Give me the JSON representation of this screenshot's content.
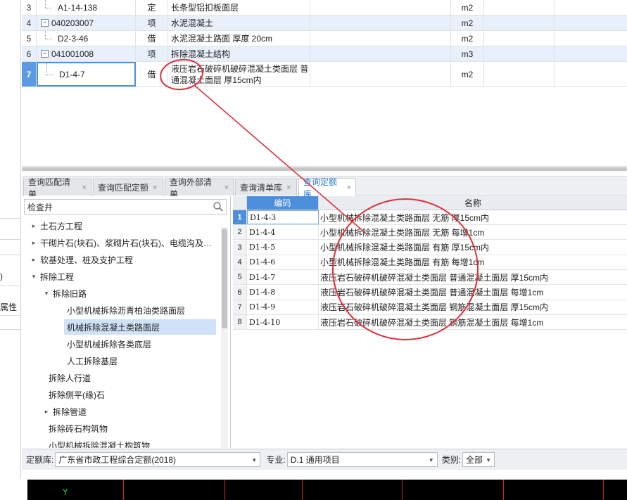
{
  "top_rows": [
    {
      "num": "3",
      "code": "A1-14-138",
      "type": "定",
      "name": "长条型铝扣板面层",
      "unit": "m2",
      "level": "child"
    },
    {
      "num": "4",
      "code": "040203007",
      "type": "项",
      "name": "水泥混凝土",
      "unit": "m2",
      "level": "parent"
    },
    {
      "num": "5",
      "code": "D2-3-46",
      "type": "借",
      "name": "水泥混凝土路面 厚度 20cm",
      "unit": "m2",
      "level": "child"
    },
    {
      "num": "6",
      "code": "041001008",
      "type": "项",
      "name": "拆除混凝土结构",
      "unit": "m3",
      "level": "parent"
    }
  ],
  "row7": {
    "num": "7",
    "code": "D1-4-7",
    "type": "借",
    "name_line1": "液压岩石破碎机破碎混凝土类面层 普",
    "name_line2": "通混凝土面层 厚15cm内",
    "unit": "m2"
  },
  "tabs": [
    {
      "label": "查询匹配清单",
      "active": false
    },
    {
      "label": "查询匹配定额",
      "active": false
    },
    {
      "label": "查询外部清单",
      "active": false
    },
    {
      "label": "查询清单库",
      "active": false
    },
    {
      "label": "查询定额库",
      "active": true
    }
  ],
  "tab_close": "×",
  "search": {
    "value": "检查井"
  },
  "tree": [
    {
      "label": "土石方工程",
      "arrow": "▸",
      "indent": 0
    },
    {
      "label": "干砌片石(块石)、浆砌片石(块石)、电缆沟及…",
      "arrow": "▸",
      "indent": 0
    },
    {
      "label": "软基处理、桩及支护工程",
      "arrow": "▸",
      "indent": 0
    },
    {
      "label": "拆除工程",
      "arrow": "▾",
      "indent": 0
    },
    {
      "label": "拆除旧路",
      "arrow": "▾",
      "indent": 1
    },
    {
      "label": "小型机械拆除沥青柏油类路面层",
      "arrow": "",
      "indent": 2
    },
    {
      "label": "机械拆除混凝土类路面层",
      "arrow": "",
      "indent": 2,
      "selected": true
    },
    {
      "label": "小型机械拆除各类底层",
      "arrow": "",
      "indent": 2
    },
    {
      "label": "人工拆除基层",
      "arrow": "",
      "indent": 2
    },
    {
      "label": "拆除人行道",
      "arrow": "",
      "indent": 1
    },
    {
      "label": "拆除侧平(缘)石",
      "arrow": "",
      "indent": 1
    },
    {
      "label": "拆除管道",
      "arrow": "▸",
      "indent": 1
    },
    {
      "label": "拆除砖石构筑物",
      "arrow": "",
      "indent": 1
    },
    {
      "label": "小型机械拆除混凝土构筑物",
      "arrow": "",
      "indent": 1
    }
  ],
  "result_headers": {
    "code": "编码",
    "name": "名称"
  },
  "results": [
    {
      "num": "1",
      "code": "D1-4-3",
      "name": "小型机械拆除混凝土类路面层 无筋 厚15cm内"
    },
    {
      "num": "2",
      "code": "D1-4-4",
      "name": "小型机械拆除混凝土类路面层 无筋 每增1cm"
    },
    {
      "num": "3",
      "code": "D1-4-5",
      "name": "小型机械拆除混凝土类路面层 有筋 厚15cm内"
    },
    {
      "num": "4",
      "code": "D1-4-6",
      "name": "小型机械拆除混凝土类路面层 有筋 每增1cm"
    },
    {
      "num": "5",
      "code": "D1-4-7",
      "name": "液压岩石破碎机破碎混凝土类面层 普通混凝土面层 厚15cm内"
    },
    {
      "num": "6",
      "code": "D1-4-8",
      "name": "液压岩石破碎机破碎混凝土类面层 普通混凝土面层 每增1cm"
    },
    {
      "num": "7",
      "code": "D1-4-9",
      "name": "液压岩石破碎机破碎混凝土类面层 钢筋混凝土面层 厚15cm内"
    },
    {
      "num": "8",
      "code": "D1-4-10",
      "name": "液压岩石破碎机破碎混凝土类面层 钢筋混凝土面层 每增1cm"
    }
  ],
  "filter": {
    "lib_label": "定额库:",
    "lib_value": "广东省市政工程综合定额(2018)",
    "major_label": "专业:",
    "major_value": "D.1 通用项目",
    "cat_label": "类别:",
    "cat_value": "全部"
  },
  "left_strip": {
    "text1": ")",
    "text2": "属性"
  },
  "bottom_mark": "Y",
  "colors": {
    "accent": "#4d8fdc",
    "annotation": "#e0303a",
    "highlight_row": "#e8f0fb"
  }
}
